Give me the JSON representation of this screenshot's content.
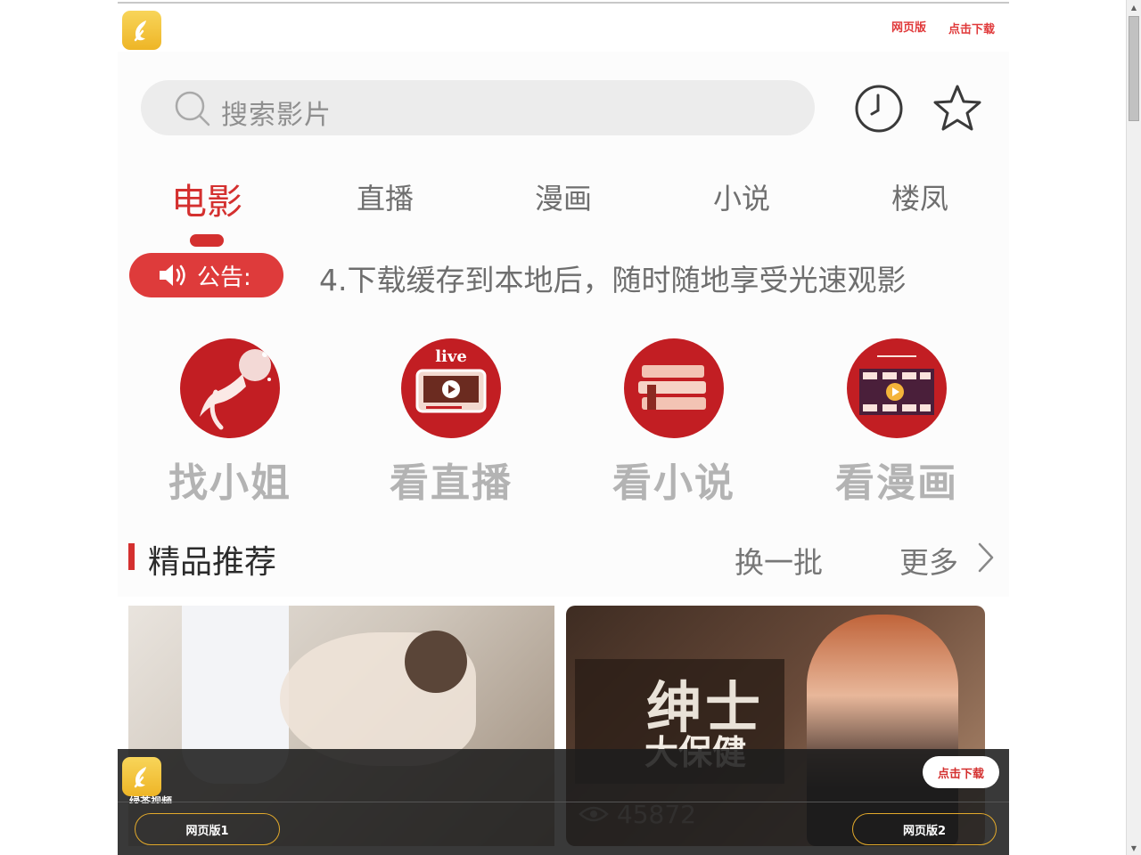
{
  "header": {
    "links": {
      "web_version": "网页版",
      "download": "点击下载"
    }
  },
  "search": {
    "placeholder": "搜索影片"
  },
  "tabs": [
    {
      "label": "电影",
      "active": true
    },
    {
      "label": "直播",
      "active": false
    },
    {
      "label": "漫画",
      "active": false
    },
    {
      "label": "小说",
      "active": false
    },
    {
      "label": "楼凤",
      "active": false
    }
  ],
  "notice": {
    "badge": "公告:",
    "text": "4.下载缓存到本地后，随时随地享受光速观影"
  },
  "categories": [
    {
      "label": "找小姐",
      "icon": "woman-figure-icon"
    },
    {
      "label": "看直播",
      "icon": "live-tv-icon",
      "icon_text": "live"
    },
    {
      "label": "看小说",
      "icon": "books-icon"
    },
    {
      "label": "看漫画",
      "icon": "film-strip-icon"
    }
  ],
  "section": {
    "title": "精品推荐",
    "refresh": "换一批",
    "more": "更多"
  },
  "videos": [
    {
      "overlay_title": "",
      "views": ""
    },
    {
      "overlay_title": "绅士",
      "overlay_subtitle": "大保健",
      "views": "45872"
    }
  ],
  "banner": {
    "app_name": "绿茶视频",
    "download": "点击下载",
    "web1": "网页版1",
    "web2": "网页版2"
  },
  "colors": {
    "accent": "#d4302f",
    "logo": "#f0bb2c",
    "banner_border": "#e2a92b"
  }
}
